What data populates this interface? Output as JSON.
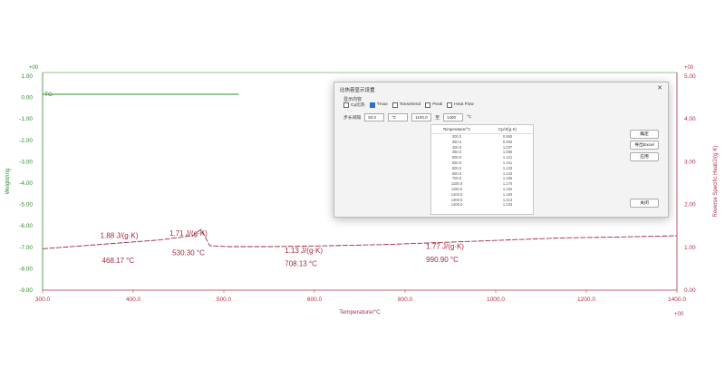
{
  "chart_data": {
    "type": "line",
    "title": "",
    "xlabel": "Temperature/°C",
    "ylabel_left": "Weight/mg",
    "ylabel_right": "Reverse Specific Heat/J/(g·K)",
    "xlim": [
      300,
      1400
    ],
    "ylim_left": [
      -9,
      1
    ],
    "ylim_right": [
      0,
      5
    ],
    "x_ticks": [
      "300.0",
      "400.0",
      "500.0",
      "600.0",
      "800.0",
      "1000.0",
      "1200.0",
      "1400.0"
    ],
    "y_ticks_left": [
      "1.00",
      "0.00",
      "-1.00",
      "-2.00",
      "-3.00",
      "-4.00",
      "-5.00",
      "-6.00",
      "-7.00",
      "-8.00",
      "-9.00"
    ],
    "y_ticks_right": [
      "5.00",
      "4.00",
      "3.00",
      "2.00",
      "1.00",
      "0.00"
    ],
    "corner_top_left": "+00",
    "corner_top_right": "+00",
    "corner_bottom_right": "+00",
    "series": [
      {
        "name": "TG",
        "axis": "left",
        "color": "#2e8b2e",
        "x": [
          300,
          430,
          520,
          570,
          640
        ],
        "y": [
          0.0,
          0.0,
          0.0,
          0.0,
          0.0
        ]
      },
      {
        "name": "Cp",
        "axis": "right",
        "color": "#a0283f",
        "x": [
          300,
          400,
          500,
          560,
          575,
          590,
          620,
          700,
          800,
          900,
          1000,
          1100,
          1200,
          1300,
          1400
        ],
        "y": [
          0.95,
          1.05,
          1.15,
          1.25,
          1.4,
          1.02,
          1.0,
          1.0,
          1.02,
          1.05,
          1.1,
          1.15,
          1.2,
          1.22,
          1.25
        ]
      }
    ],
    "annotations": [
      {
        "text": "1.88 J/(g·K)",
        "x": 400,
        "y": 1.2
      },
      {
        "text": "468.17 °C",
        "x": 403,
        "y": 0.62
      },
      {
        "text": "1.71 J/(g·K)",
        "x": 520,
        "y": 1.25
      },
      {
        "text": "530.30 °C",
        "x": 525,
        "y": 0.8
      },
      {
        "text": "1.13 J/(g·K)",
        "x": 720,
        "y": 0.85
      },
      {
        "text": "708.13 °C",
        "x": 720,
        "y": 0.55
      },
      {
        "text": "1.77 J/(g·K)",
        "x": 965,
        "y": 0.95
      },
      {
        "text": "990.90 °C",
        "x": 965,
        "y": 0.65
      }
    ],
    "legend": "TG",
    "legend_placement": "top-left",
    "grid": false
  },
  "dialog": {
    "title": "比热容显示设置",
    "close": "✕",
    "group_label": "显示内容",
    "options": [
      {
        "label": "Cp比热",
        "checked": false
      },
      {
        "label": "Tmax",
        "checked": true
      },
      {
        "label": "Tonset/end",
        "checked": false
      },
      {
        "label": "Peak",
        "checked": false
      },
      {
        "label": "Heat Flow",
        "checked": false
      }
    ],
    "ctrl_label": "步长间隔",
    "ctrl_value": "50.0",
    "ctrl_unit": "°C",
    "range_from": "1100.0",
    "range_label": "至",
    "range_to": "1400",
    "range_unit": "°C",
    "table_headers": [
      "Temperature/°C",
      "Cp/J/(g·K)"
    ],
    "table_rows": [
      [
        "300.0",
        "0.950"
      ],
      [
        "350.0",
        "0.993"
      ],
      [
        "400.0",
        "1.037"
      ],
      [
        "450.0",
        "1.080"
      ],
      [
        "500.0",
        "1.121"
      ],
      [
        "550.0",
        "1.151"
      ],
      [
        "600.0",
        "1.133"
      ],
      [
        "650.0",
        "1.143"
      ],
      [
        "700.0",
        "1.155"
      ],
      [
        "1100.0",
        "1.170"
      ],
      [
        "1150.0",
        "1.182"
      ],
      [
        "1200.0",
        "1.193"
      ],
      [
        "1300.0",
        "1.213"
      ],
      [
        "1400.0",
        "1.233"
      ]
    ],
    "buttons": {
      "ok": "确定",
      "export": "导出Excel",
      "apply": "应用",
      "close": "关闭"
    }
  }
}
